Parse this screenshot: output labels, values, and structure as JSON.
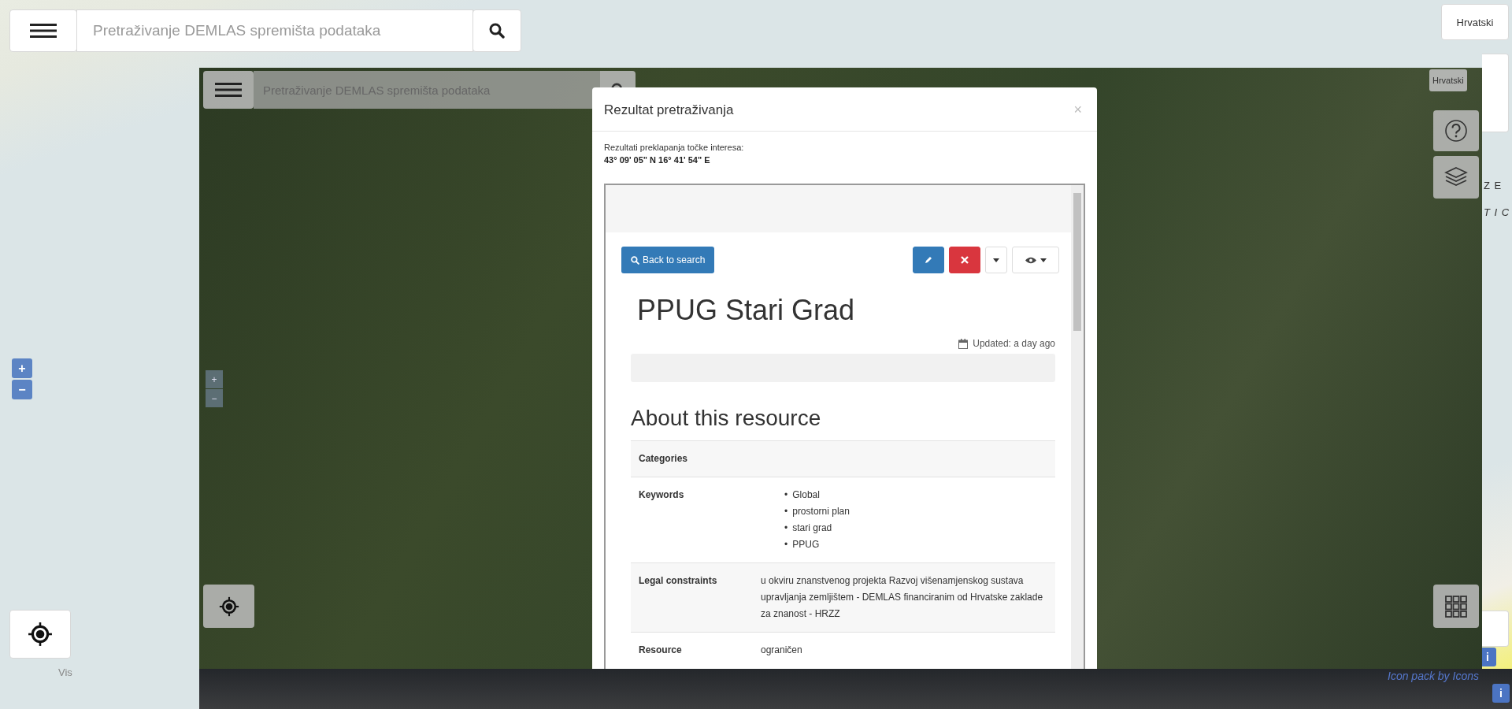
{
  "outer_map": {
    "search_placeholder": "Pretraživanje DEMLAS spremišta podataka",
    "language": "Hrvatski",
    "zoom_in": "+",
    "zoom_out": "−",
    "place_label": "Vis",
    "side_labels": [
      "Z E",
      "T I C"
    ],
    "attribution": "Icon pack by Icons",
    "info_buttons": [
      "i",
      "i"
    ]
  },
  "inner_screenshot": {
    "search_placeholder": "Pretraživanje DEMLAS spremišta podataka",
    "language": "Hrvatski",
    "zoom_in": "+",
    "zoom_out": "−",
    "modal": {
      "title": "Rezultat pretraživanja",
      "close": "×",
      "intro": "Rezultati preklapanja točke interesa:",
      "coordinates": "43° 09' 05\" N 16° 41' 54\" E",
      "resource": {
        "back_button": "Back to search",
        "title": "PPUG Stari Grad",
        "updated": "Updated: a day ago",
        "section_heading": "About this resource",
        "rows": [
          {
            "label": "Categories",
            "kind": "text"
          },
          {
            "label": "Keywords",
            "kind": "list",
            "bullet": "•",
            "items": [
              "Global",
              "prostorni plan",
              "stari grad",
              "PPUG"
            ]
          },
          {
            "label": "Legal constraints",
            "kind": "text",
            "value": "u okviru znanstvenog projekta Razvoj višenamjenskog sustava upravljanja zemljištem - DEMLAS financiranim od Hrvatske zaklade za znanost - HRZZ"
          },
          {
            "label": "Resource",
            "kind": "text",
            "value": "ograničen"
          }
        ]
      }
    }
  }
}
